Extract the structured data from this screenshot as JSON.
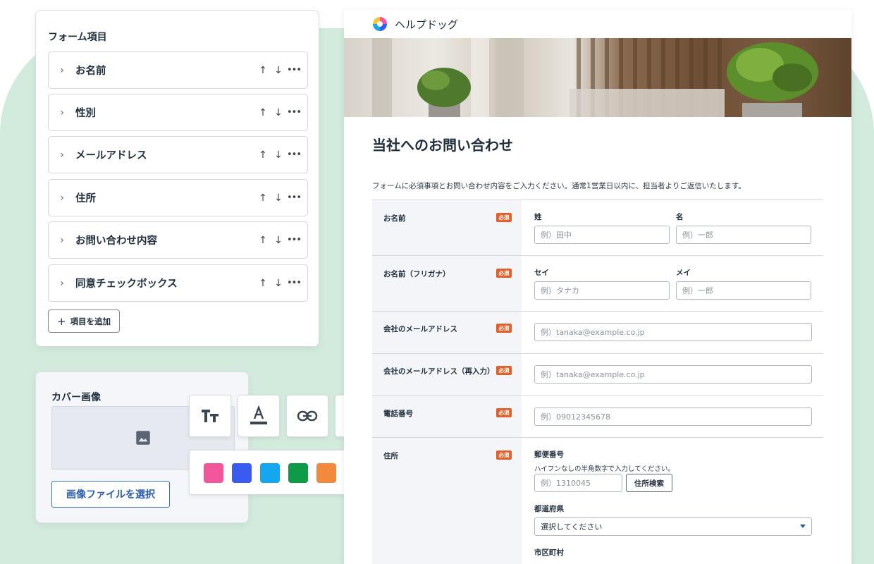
{
  "items_panel": {
    "title": "フォーム項目",
    "items": [
      {
        "label": "お名前"
      },
      {
        "label": "性別"
      },
      {
        "label": "メールアドレス"
      },
      {
        "label": "住所"
      },
      {
        "label": "お問い合わせ内容"
      },
      {
        "label": "同意チェックボックス"
      }
    ],
    "add_button": "項目を追加"
  },
  "cover_panel": {
    "title": "カバー画像",
    "select_button": "画像ファイルを選択"
  },
  "toolbar": {
    "tools": [
      "text-size-icon",
      "text-color-icon",
      "link-icon",
      "fill-color-icon"
    ]
  },
  "palette": {
    "colors": [
      "#f2569b",
      "#3a5bf0",
      "#14a7f0",
      "#0e9a46",
      "#f18a3c",
      "#f8c62f"
    ]
  },
  "preview": {
    "brand": "ヘルプドッグ",
    "title": "当社へのお問い合わせ",
    "description": "フォームに必須事項とお問い合わせ内容をご入力ください。通常1営業日以内に、担当者よりご返信いたします。",
    "required_badge": "必須",
    "fields": {
      "name": {
        "label": "お名前",
        "sei_label": "姓",
        "sei_placeholder": "例）田中",
        "mei_label": "名",
        "mei_placeholder": "例）一郎"
      },
      "kana": {
        "label": "お名前（フリガナ）",
        "sei_label": "セイ",
        "sei_placeholder": "例）タナカ",
        "mei_label": "メイ",
        "mei_placeholder": "例）一郎"
      },
      "email": {
        "label": "会社のメールアドレス",
        "placeholder": "例）tanaka@example.co.jp"
      },
      "email_confirm": {
        "label": "会社のメールアドレス（再入力）",
        "placeholder": "例）tanaka@example.co.jp"
      },
      "phone": {
        "label": "電話番号",
        "placeholder": "例）09012345678"
      },
      "address": {
        "label": "住所",
        "postal_label": "郵便番号",
        "postal_hint": "ハイフンなしの半角数字で入力してください。",
        "postal_placeholder": "例）1310045",
        "search_button": "住所検索",
        "prefecture_label": "都道府県",
        "prefecture_value": "選択してください",
        "city_label": "市区町村"
      }
    }
  }
}
